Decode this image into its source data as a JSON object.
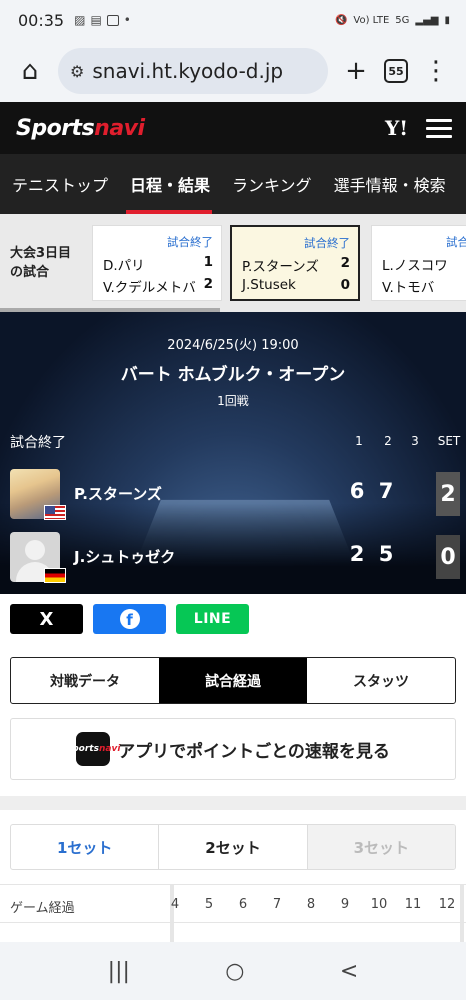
{
  "status_bar": {
    "time": "00:35",
    "network_label": "5G",
    "volte_label": "Vo) LTE"
  },
  "browser": {
    "url": "snavi.ht.kyodo-d.jp",
    "tab_count": "55"
  },
  "site": {
    "logo_main": "Sports",
    "logo_accent": "navi",
    "yahoo_label": "Y!"
  },
  "nav": {
    "tabs": [
      "テニストップ",
      "日程・結果",
      "ランキング",
      "選手情報・検索"
    ],
    "active_index": 1
  },
  "day_strip": {
    "label_line1": "大会3日目",
    "label_line2": "の試合",
    "cards": [
      {
        "status": "試合終了",
        "p1": "D.パリ",
        "s1": "1",
        "p2": "V.クデルメトバ",
        "s2": "2"
      },
      {
        "status": "試合終了",
        "p1": "P.スターンズ",
        "s1": "2",
        "p2": "J.Stusek",
        "s2": "0"
      },
      {
        "status": "試合終了",
        "p1": "L.ノスコワ",
        "s1": "",
        "p2": "V.トモバ",
        "s2": ""
      }
    ]
  },
  "match": {
    "datetime": "2024/6/25(火) 19:00",
    "tournament": "バート ホムブルク・オープン",
    "round": "1回戦",
    "status": "試合終了",
    "columns": [
      "1",
      "2",
      "3",
      "SET"
    ],
    "players": [
      {
        "name": "P.スターンズ",
        "country": "USA",
        "games": [
          "6",
          "7"
        ],
        "sets": "2"
      },
      {
        "name": "J.シュトゥゼク",
        "country": "GER",
        "games": [
          "2",
          "5"
        ],
        "sets": "0"
      }
    ]
  },
  "share": {
    "x_label": "X",
    "facebook_label": "f",
    "line_label": "LINE"
  },
  "view_tabs": {
    "tabs": [
      "対戦データ",
      "試合経過",
      "スタッツ"
    ],
    "active_index": 1
  },
  "app_banner": {
    "icon_main": "Sports",
    "icon_accent": "navi",
    "text": "アプリでポイントごとの速報を見る"
  },
  "set_tabs": [
    "1セット",
    "2セット",
    "3セット"
  ],
  "games_header": {
    "label": "ゲーム経過",
    "numbers": [
      "4",
      "5",
      "6",
      "7",
      "8",
      "9",
      "10",
      "11",
      "12"
    ]
  },
  "android_nav": {
    "recents": "|||",
    "home": "○",
    "back": "<"
  },
  "colors": {
    "accent_red": "#e01e2d",
    "link_blue": "#2a6fcf",
    "facebook": "#1877f2",
    "line": "#06c755"
  }
}
